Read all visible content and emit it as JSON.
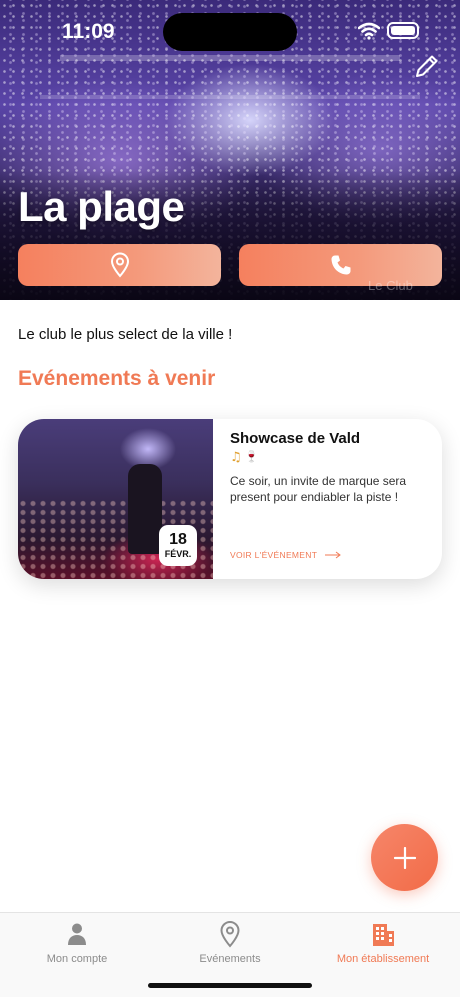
{
  "status_bar": {
    "time": "11:09"
  },
  "header": {
    "title": "La plage",
    "watermark": "Le Club",
    "edit_icon": "pencil-icon",
    "buttons": [
      {
        "icon": "map-pin-icon"
      },
      {
        "icon": "phone-icon"
      }
    ]
  },
  "main": {
    "description": "Le club le plus select de la ville !",
    "section_title": "Evénements à venir",
    "events": [
      {
        "title": "Showcase de Vald",
        "tags": [
          "♫",
          "🍷"
        ],
        "description": "Ce soir, un invite de marque sera present pour endiabler la piste !",
        "date_day": "18",
        "date_month": "FÉVR.",
        "link_label": "VOIR L'ÉVÉNEMENT"
      }
    ]
  },
  "fab": {
    "icon": "plus-icon"
  },
  "tab_bar": {
    "tabs": [
      {
        "label": "Mon compte",
        "icon": "user-icon"
      },
      {
        "label": "Evénements",
        "icon": "location-pin-icon"
      },
      {
        "label": "Mon établissement",
        "icon": "building-icon"
      }
    ],
    "active_color": "#f07a55",
    "inactive_color": "#8c8c8c"
  },
  "colors": {
    "accent": "#f07a55",
    "button_gradient_start": "#f5805e",
    "button_gradient_end": "#f3b49c"
  }
}
